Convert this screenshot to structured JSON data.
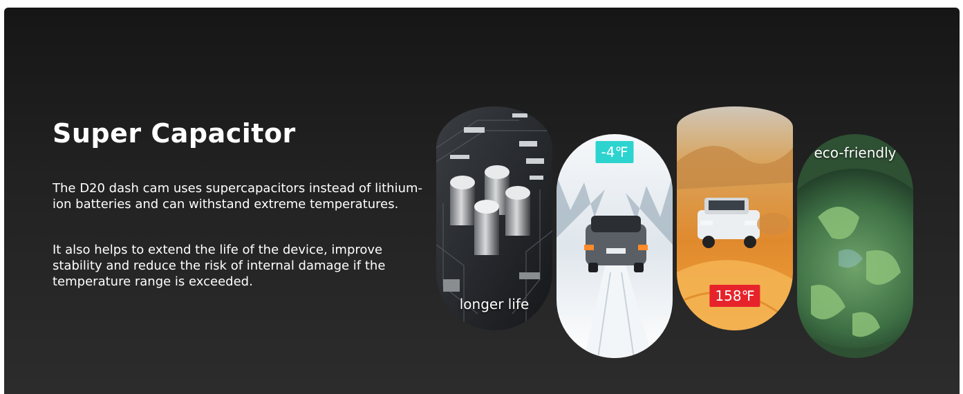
{
  "section": {
    "title": "Super Capacitor",
    "paragraphs": [
      "The D20 dash cam uses supercapacitors instead of lithium-ion batteries and can withstand extreme temperatures.",
      "It also helps to extend the life of the device, improve stability and reduce the risk of internal damage if the temperature range is exceeded."
    ]
  },
  "cards": [
    {
      "caption": "longer life",
      "icon": "circuit-board-capacitors-image"
    },
    {
      "badge": "-4℉",
      "badge_color": "#2dd4cf",
      "icon": "car-in-snow-image"
    },
    {
      "badge": "158℉",
      "badge_color": "#e6232a",
      "icon": "suv-in-desert-image"
    },
    {
      "caption": "eco-friendly",
      "icon": "green-earth-image"
    }
  ],
  "colors": {
    "background": "#1c1c1c",
    "text": "#ffffff"
  }
}
